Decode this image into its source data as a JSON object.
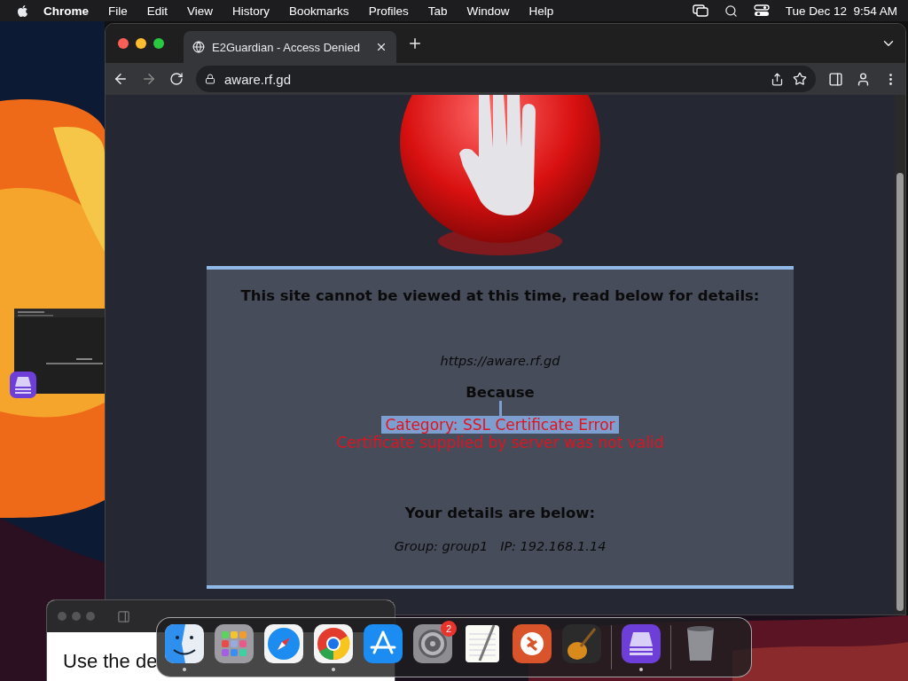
{
  "menubar": {
    "app": "Chrome",
    "menus": [
      "File",
      "Edit",
      "View",
      "History",
      "Bookmarks",
      "Profiles",
      "Tab",
      "Window",
      "Help"
    ],
    "clock": "Tue Dec 12  9:54 AM"
  },
  "browser": {
    "tabs": [
      {
        "title": "E2Guardian - Access Denied",
        "selected": true
      }
    ],
    "url": "aware.rf.gd"
  },
  "page": {
    "heading": "This site cannot be viewed at this time, read below for details:",
    "blocked_url": "https://aware.rf.gd",
    "because": "Because",
    "category": {
      "text": "Category: SSL Certificate Error",
      "highlighted": true
    },
    "reason": "Certificate supplied by server was not valid",
    "details_heading": "Your details are below:",
    "group": "Group: group1",
    "ip": "IP: 192.168.1.14"
  },
  "background_window": {
    "text": "Use the de"
  },
  "dock": {
    "items": [
      {
        "kind": "finder",
        "running": true
      },
      {
        "kind": "launchpad",
        "running": false
      },
      {
        "kind": "safari",
        "running": false
      },
      {
        "kind": "chrome",
        "running": true
      },
      {
        "kind": "appstore",
        "running": false
      },
      {
        "kind": "settings",
        "running": false,
        "badge": "2"
      },
      {
        "kind": "textedit",
        "running": false
      },
      {
        "kind": "remote",
        "running": false
      },
      {
        "kind": "guitar",
        "running": false
      },
      {
        "kind": "separator"
      },
      {
        "kind": "configurator",
        "running": true
      },
      {
        "kind": "separator"
      },
      {
        "kind": "trash",
        "running": false
      }
    ]
  }
}
